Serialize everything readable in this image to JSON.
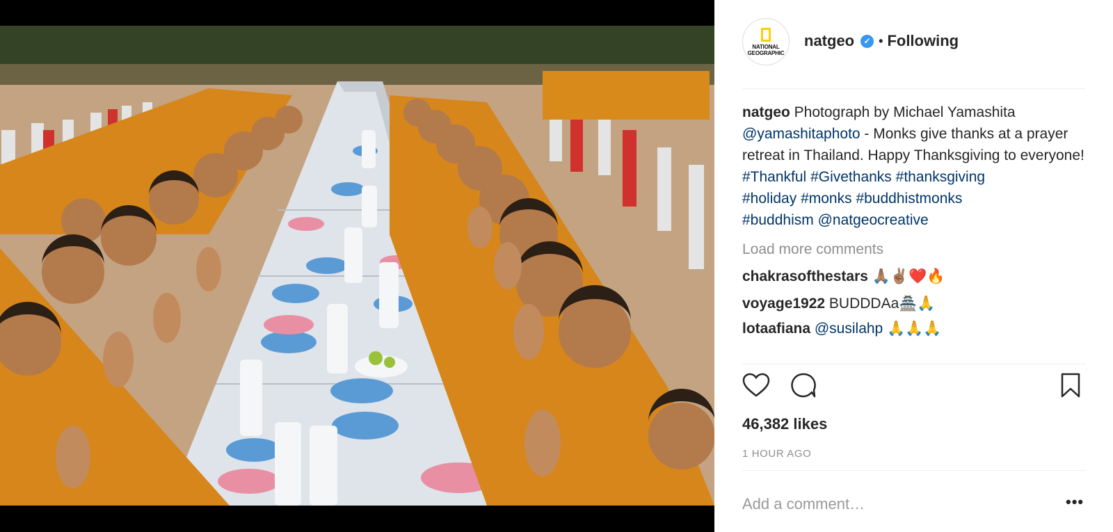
{
  "photo": {
    "description_icon": "monks-table-photo"
  },
  "header": {
    "avatar_text_top": "NATIONAL",
    "avatar_text_bottom": "GEOGRAPHIC",
    "username": "natgeo",
    "verified_icon": "verified-badge-icon",
    "separator": "•",
    "follow_status": "Following"
  },
  "caption": {
    "username": "natgeo",
    "text_part1": " Photograph by Michael Yamashita ",
    "mention": "@yamashitaphoto",
    "text_part2": " - Monks give thanks at a prayer retreat in Thailand. Happy Thanksgiving to everyone!",
    "hashtags": [
      "#Thankful",
      "#Givethanks",
      "#thanksgiving",
      "#holiday",
      "#monks",
      "#buddhistmonks",
      "#buddhism"
    ],
    "trailing_mention": "@natgeocreative"
  },
  "load_more": "Load more comments",
  "comments": [
    {
      "username": "chakrasofthestars",
      "text": " 🙏🏽✌🏽❤️🔥"
    },
    {
      "username": "voyage1922",
      "text": " BUDDDAa🏯🙏"
    },
    {
      "username": "lotaafiana",
      "text": " @susilahp 🙏🙏🙏"
    }
  ],
  "actions": {
    "like_icon": "heart-icon",
    "comment_icon": "comment-bubble-icon",
    "save_icon": "bookmark-icon"
  },
  "likes": "46,382 likes",
  "timestamp": "1 HOUR AGO",
  "add_comment_placeholder": "Add a comment…",
  "more_label": "•••",
  "colors": {
    "link": "#003569",
    "verified": "#3897f0",
    "muted": "#8e8e8e",
    "robe": "#d88a1a"
  }
}
